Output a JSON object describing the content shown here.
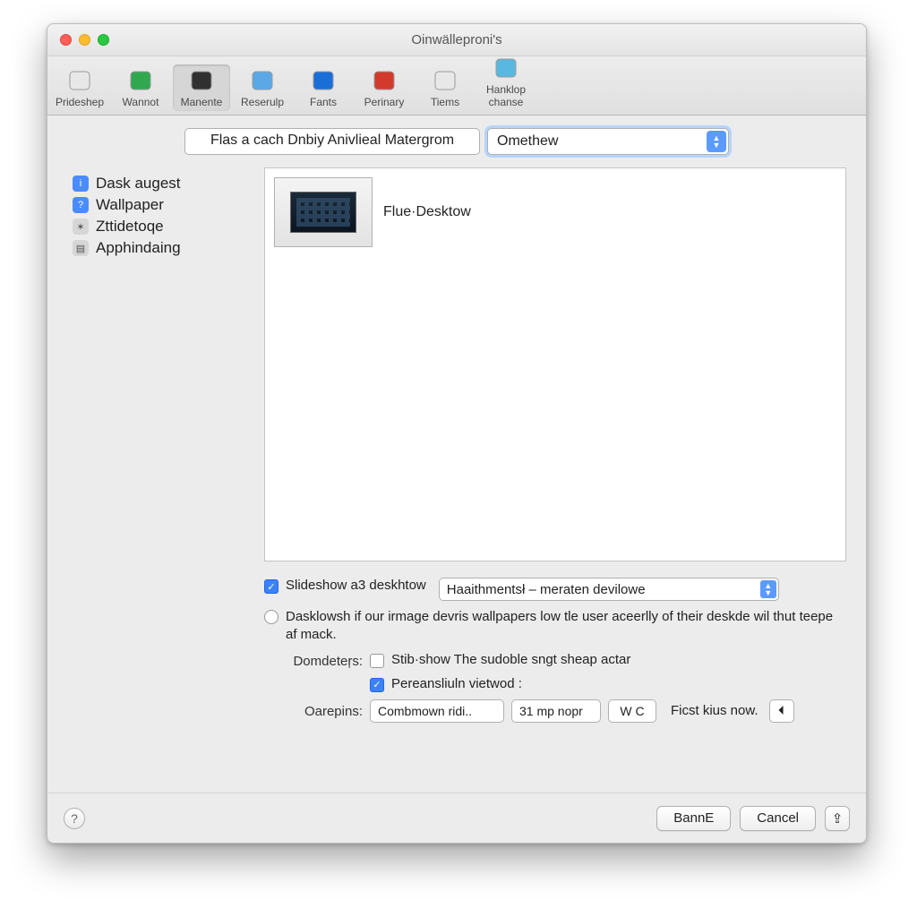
{
  "window": {
    "title": "Oinwälleproni's"
  },
  "toolbar": {
    "items": [
      {
        "label": "Prideshep",
        "color": "#e8e8e8"
      },
      {
        "label": "Wannot",
        "color": "#2fa84f"
      },
      {
        "label": "Manente",
        "color": "#303030",
        "selected": true
      },
      {
        "label": "Reserulp",
        "color": "#5aa9e6"
      },
      {
        "label": "Fants",
        "color": "#1a6ed8"
      },
      {
        "label": "Perinary",
        "color": "#d23b2b"
      },
      {
        "label": "Tiems",
        "color": "#e8e8e8"
      },
      {
        "label": "Hanklop chanse",
        "color": "#5ab8e0"
      }
    ]
  },
  "header": {
    "prompt": "Flas a cach Dnbiy Anivlieal Matergrom",
    "select_value": "Omethew"
  },
  "sidebar": {
    "items": [
      {
        "label": "Dask augest",
        "icon_bg": "#4a8cff",
        "glyph": "i"
      },
      {
        "label": "Wallpaper",
        "icon_bg": "#4a8cff",
        "glyph": "?"
      },
      {
        "label": "Zttidetoqe",
        "icon_bg": "#d6d6d6",
        "glyph": "✶"
      },
      {
        "label": "Apphindaing",
        "icon_bg": "#d6d6d6",
        "glyph": "▤"
      }
    ]
  },
  "preview": {
    "thumb_label": "Flue·Desktow"
  },
  "options": {
    "slideshow": {
      "checked": true,
      "label": "Slideshow a3 deskhtow",
      "select": "Haaithmentsł – meraten devilowe"
    },
    "radio_text": "Dasklowsh if our irmage devris wallpapers low tle user aceerlly of their deskde wil thut teepe af mack.",
    "domdeters_label": "Domdeteŗs:",
    "sub1": {
      "checked": false,
      "label": "Stib·show The sudoble sngt sheap actar"
    },
    "sub2": {
      "checked": true,
      "label": "Pereansliuln vietwod :"
    },
    "oarepins_label": "Oarepins:",
    "field1": "Combmown ridi..",
    "field2": "31 mp nopr",
    "field3": "W   C",
    "field4_label": "Ficst kius now.",
    "field4_btn": "⏴"
  },
  "footer": {
    "ok": "BannE",
    "cancel": "Cancel"
  },
  "colors": {
    "accent": "#3b82f6"
  }
}
